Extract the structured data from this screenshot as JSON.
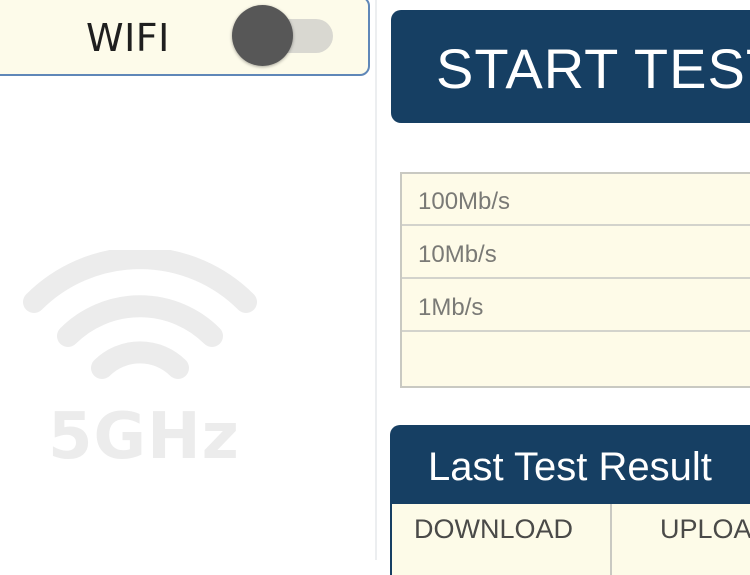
{
  "wifi": {
    "label": "WIFI",
    "toggle_on": false
  },
  "watermark": {
    "band_label": "5GHz",
    "icon": "wifi-signal-icon"
  },
  "start_test": {
    "label": "START TEST"
  },
  "speed_scale": {
    "labels": [
      "100Mb/s",
      "10Mb/s",
      "1Mb/s"
    ]
  },
  "last_result": {
    "title": "Last Test Result",
    "columns": [
      "DOWNLOAD",
      "UPLOAD"
    ]
  },
  "colors": {
    "accent": "#163f63",
    "panel_bg": "#fdfbea",
    "border_blue": "#5f87b8"
  }
}
